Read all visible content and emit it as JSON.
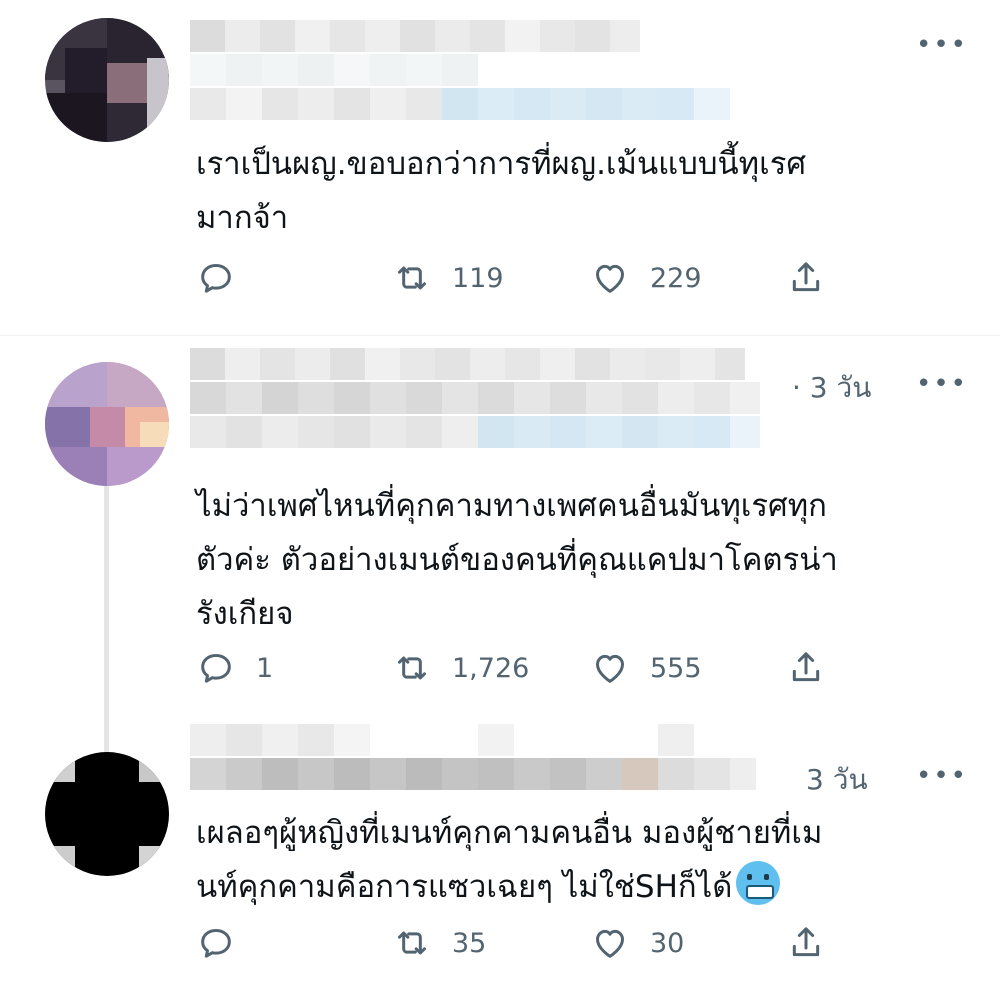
{
  "tweets": [
    {
      "time": "",
      "text_lines": [
        "เราเป็นผญ.ขอบอกว่าการที่ผญ.เม้นแบบนี้ทุเรศ",
        "มากจ้า"
      ],
      "reply_count": "",
      "retweet_count": "119",
      "like_count": "229",
      "more": "•••"
    },
    {
      "time": "· 3 วัน",
      "text_lines": [
        "ไม่ว่าเพศไหนที่คุกคามทางเพศคนอื่นมันทุเรศทุก",
        "ตัวค่ะ ตัวอย่างเมนต์ของคนที่คุณแคปมาโคตรน่า",
        "รังเกียจ"
      ],
      "reply_count": "1",
      "retweet_count": "1,726",
      "like_count": "555",
      "more": "•••"
    },
    {
      "time": "3 วัน",
      "text_lines": [
        "เผลอๆผู้หญิงที่เมนท์คุกคามคนอื่น มองผู้ชายที่เม",
        "นท์คุกคามคือการแซวเฉยๆ ไม่ใช่SHก็ได้"
      ],
      "reply_count": "",
      "retweet_count": "35",
      "like_count": "30",
      "more": "•••",
      "emoji": "cold-face-emoji"
    }
  ],
  "colors": {
    "icon": "#536471",
    "text": "#0f1419",
    "divider": "#eff3f4"
  }
}
